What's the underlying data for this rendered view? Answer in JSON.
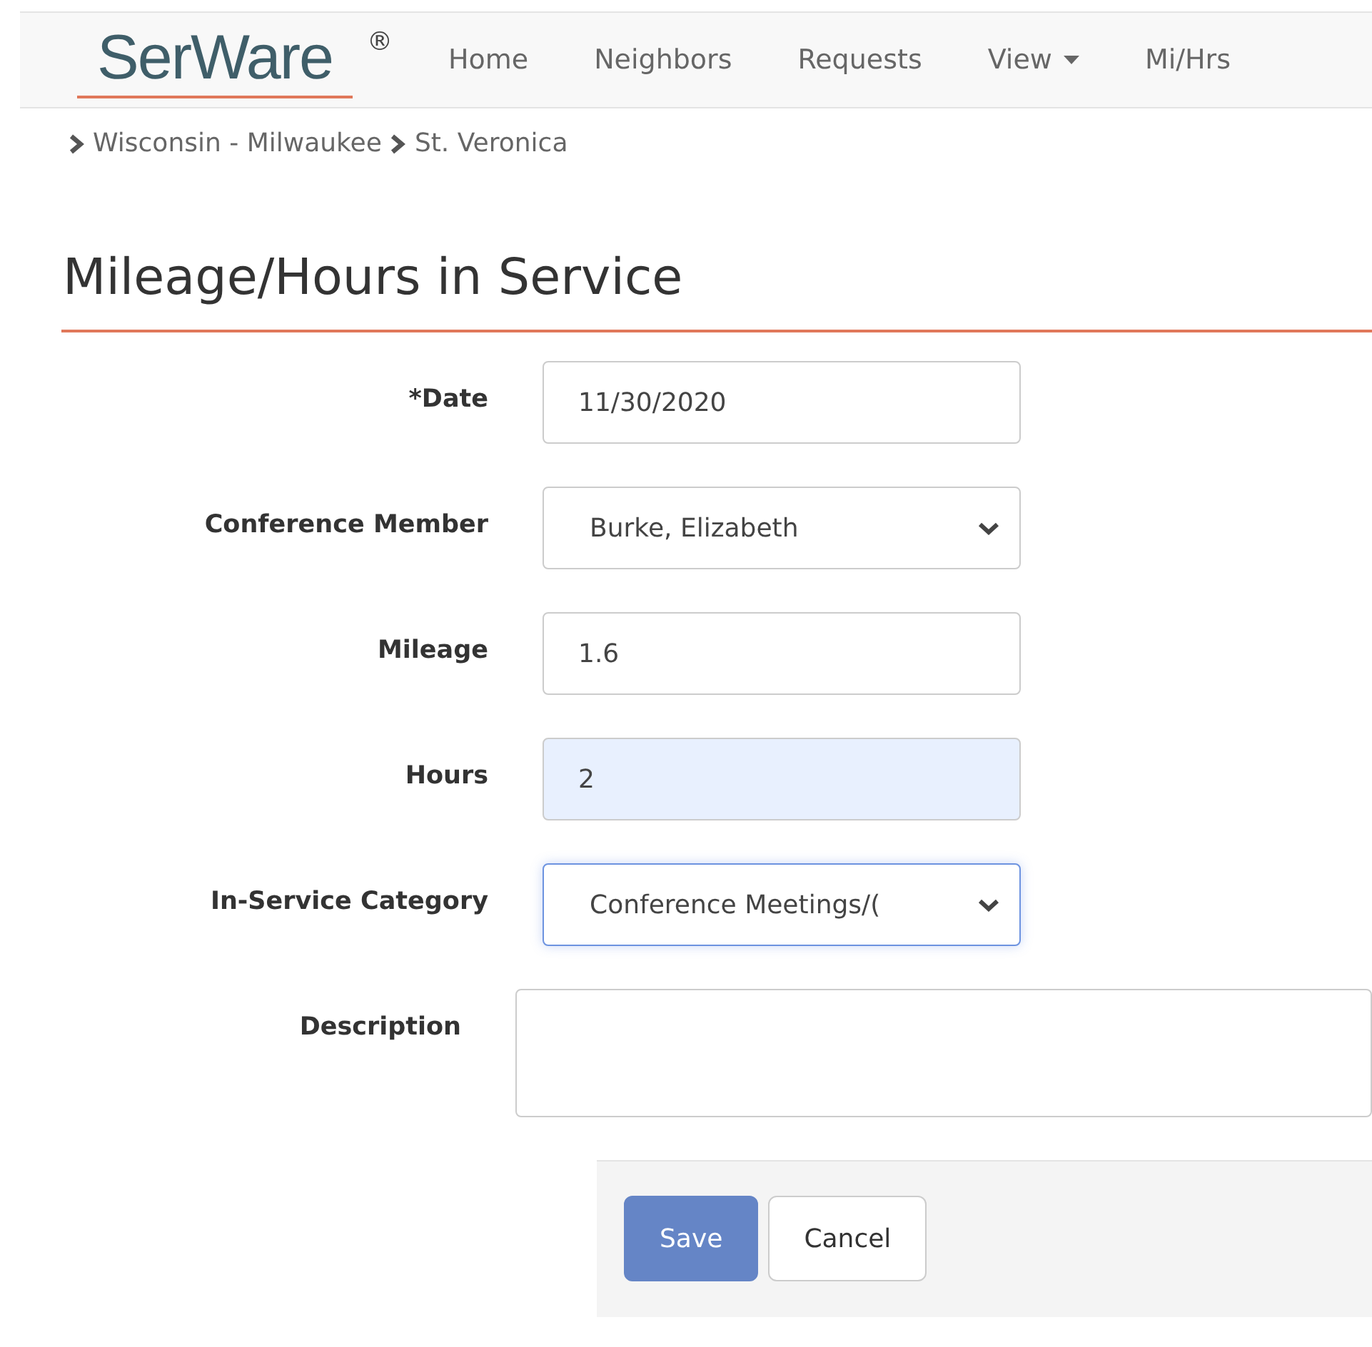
{
  "brand": {
    "name": "SerWare",
    "mark": "®"
  },
  "nav": [
    {
      "label": "Home",
      "dropdown": false
    },
    {
      "label": "Neighbors",
      "dropdown": false
    },
    {
      "label": "Requests",
      "dropdown": false
    },
    {
      "label": "View",
      "dropdown": true
    },
    {
      "label": "Mi/Hrs",
      "dropdown": false
    }
  ],
  "breadcrumb": [
    "Wisconsin - Milwaukee",
    "St. Veronica"
  ],
  "heading": "Mileage/Hours in Service",
  "fields": [
    {
      "kind": "text",
      "label": "*Date",
      "value": "11/30/2020",
      "autofilled": false,
      "focused": false
    },
    {
      "kind": "select",
      "label": "Conference Member",
      "value": "Burke, Elizabeth",
      "autofilled": false,
      "focused": false
    },
    {
      "kind": "text",
      "label": "Mileage",
      "value": "1.6",
      "autofilled": false,
      "focused": false
    },
    {
      "kind": "text",
      "label": "Hours",
      "value": "2",
      "autofilled": true,
      "focused": false
    },
    {
      "kind": "select",
      "label": "In-Service Category",
      "value": "Conference Meetings/(",
      "autofilled": false,
      "focused": true
    },
    {
      "kind": "textarea",
      "label": "Description",
      "autofilled": false,
      "focused": false
    }
  ],
  "buttons": [
    {
      "label": "Save",
      "primary": true
    },
    {
      "label": "Cancel",
      "primary": false
    }
  ]
}
